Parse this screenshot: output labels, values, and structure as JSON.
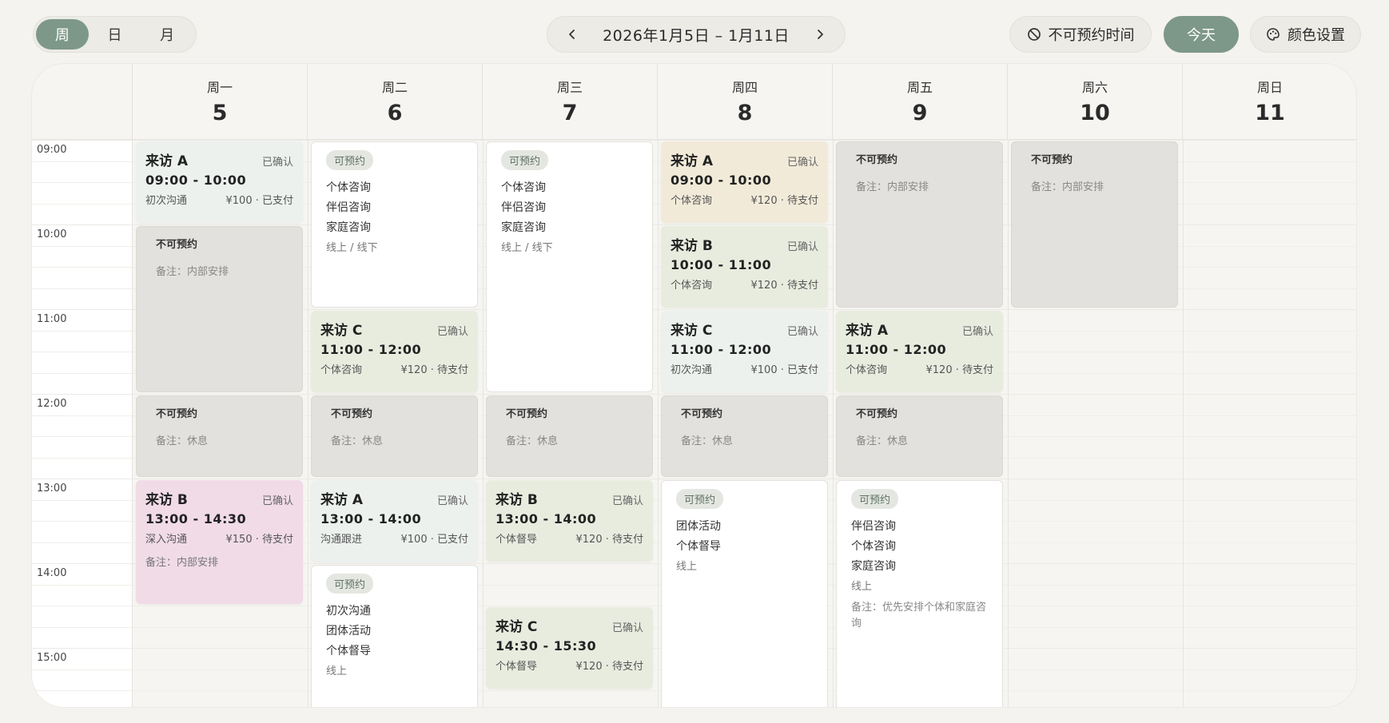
{
  "view_switch": [
    {
      "label": "周",
      "active": true
    },
    {
      "label": "日",
      "active": false
    },
    {
      "label": "月",
      "active": false
    }
  ],
  "date_nav": {
    "range": "2026年1月5日 – 1月11日",
    "prev_icon": "chevron-left-icon",
    "next_icon": "chevron-right-icon"
  },
  "actions": {
    "unavailable": "不可预约时间",
    "today": "今天",
    "color": "颜色设置"
  },
  "days": [
    {
      "name": "周一",
      "num": "5"
    },
    {
      "name": "周二",
      "num": "6"
    },
    {
      "name": "周三",
      "num": "7"
    },
    {
      "name": "周四",
      "num": "8"
    },
    {
      "name": "周五",
      "num": "9"
    },
    {
      "name": "周六",
      "num": "10"
    },
    {
      "name": "周日",
      "num": "11"
    }
  ],
  "hours": [
    "09:00",
    "10:00",
    "11:00",
    "12:00",
    "13:00",
    "14:00",
    "15:00"
  ],
  "colors": {
    "accent": "#7d9889",
    "teal": "#ecf1ee",
    "beige": "#f2ead9",
    "green": "#e8ecdf",
    "pink": "#f0dbe7",
    "blocked": "#e2e1dd"
  },
  "events": [
    {
      "day": 0,
      "start": "09:00",
      "end": "10:00",
      "kind": "booked",
      "color": "teal",
      "title": "来访 A",
      "status": "已确认",
      "time": "09:00 - 10:00",
      "service": "初次沟通",
      "price": "¥100 · 已支付"
    },
    {
      "day": 0,
      "start": "10:00",
      "end": "12:00",
      "kind": "blocked",
      "title": "不可预约",
      "note": "备注：内部安排"
    },
    {
      "day": 0,
      "start": "12:00",
      "end": "13:00",
      "kind": "blocked",
      "title": "不可预约",
      "note": "备注：休息"
    },
    {
      "day": 0,
      "start": "13:00",
      "end": "14:30",
      "kind": "booked",
      "color": "pink",
      "title": "来访 B",
      "status": "已确认",
      "time": "13:00 - 14:30",
      "service": "深入沟通",
      "price": "¥150 · 待支付",
      "note": "备注：内部安排"
    },
    {
      "day": 1,
      "start": "09:00",
      "end": "11:00",
      "kind": "open",
      "tag": "可预约",
      "items": [
        "个体咨询",
        "伴侣咨询",
        "家庭咨询"
      ],
      "mode": "线上 / 线下"
    },
    {
      "day": 1,
      "start": "11:00",
      "end": "12:00",
      "kind": "booked",
      "color": "green",
      "title": "来访 C",
      "status": "已确认",
      "time": "11:00 - 12:00",
      "service": "个体咨询",
      "price": "¥120 · 待支付"
    },
    {
      "day": 1,
      "start": "12:00",
      "end": "13:00",
      "kind": "blocked",
      "title": "不可预约",
      "note": "备注：休息"
    },
    {
      "day": 1,
      "start": "13:00",
      "end": "14:00",
      "kind": "booked",
      "color": "teal",
      "title": "来访 A",
      "status": "已确认",
      "time": "13:00 - 14:00",
      "service": "沟通跟进",
      "price": "¥100 · 已支付"
    },
    {
      "day": 1,
      "start": "14:00",
      "end": "16:00",
      "kind": "open",
      "tag": "可预约",
      "items": [
        "初次沟通",
        "团体活动",
        "个体督导"
      ],
      "mode": "线上"
    },
    {
      "day": 2,
      "start": "09:00",
      "end": "12:00",
      "kind": "open",
      "tag": "可预约",
      "items": [
        "个体咨询",
        "伴侣咨询",
        "家庭咨询"
      ],
      "mode": "线上 / 线下"
    },
    {
      "day": 2,
      "start": "12:00",
      "end": "13:00",
      "kind": "blocked",
      "title": "不可预约",
      "note": "备注：休息"
    },
    {
      "day": 2,
      "start": "13:00",
      "end": "14:00",
      "kind": "booked",
      "color": "green",
      "title": "来访 B",
      "status": "已确认",
      "time": "13:00 - 14:00",
      "service": "个体督导",
      "price": "¥120 · 待支付"
    },
    {
      "day": 2,
      "start": "14:30",
      "end": "15:30",
      "kind": "booked",
      "color": "green",
      "title": "来访 C",
      "status": "已确认",
      "time": "14:30 - 15:30",
      "service": "个体督导",
      "price": "¥120 · 待支付"
    },
    {
      "day": 3,
      "start": "09:00",
      "end": "10:00",
      "kind": "booked",
      "color": "beige",
      "title": "来访 A",
      "status": "已确认",
      "time": "09:00 - 10:00",
      "service": "个体咨询",
      "price": "¥120 · 待支付"
    },
    {
      "day": 3,
      "start": "10:00",
      "end": "11:00",
      "kind": "booked",
      "color": "green",
      "title": "来访 B",
      "status": "已确认",
      "time": "10:00 - 11:00",
      "service": "个体咨询",
      "price": "¥120 · 待支付"
    },
    {
      "day": 3,
      "start": "11:00",
      "end": "12:00",
      "kind": "booked",
      "color": "teal",
      "title": "来访 C",
      "status": "已确认",
      "time": "11:00 - 12:00",
      "service": "初次沟通",
      "price": "¥100 · 已支付"
    },
    {
      "day": 3,
      "start": "12:00",
      "end": "13:00",
      "kind": "blocked",
      "title": "不可预约",
      "note": "备注：休息"
    },
    {
      "day": 3,
      "start": "13:00",
      "end": "16:00",
      "kind": "open",
      "tag": "可预约",
      "items": [
        "团体活动",
        "个体督导"
      ],
      "mode": "线上"
    },
    {
      "day": 4,
      "start": "09:00",
      "end": "11:00",
      "kind": "blocked",
      "title": "不可预约",
      "note": "备注：内部安排"
    },
    {
      "day": 4,
      "start": "11:00",
      "end": "12:00",
      "kind": "booked",
      "color": "green",
      "title": "来访 A",
      "status": "已确认",
      "time": "11:00 - 12:00",
      "service": "个体咨询",
      "price": "¥120 · 待支付"
    },
    {
      "day": 4,
      "start": "12:00",
      "end": "13:00",
      "kind": "blocked",
      "title": "不可预约",
      "note": "备注：休息"
    },
    {
      "day": 4,
      "start": "13:00",
      "end": "16:00",
      "kind": "open",
      "tag": "可预约",
      "items": [
        "伴侣咨询",
        "个体咨询",
        "家庭咨询"
      ],
      "mode": "线上",
      "note": "备注：优先安排个体和家庭咨询"
    },
    {
      "day": 5,
      "start": "09:00",
      "end": "11:00",
      "kind": "blocked",
      "title": "不可预约",
      "note": "备注：内部安排"
    }
  ]
}
